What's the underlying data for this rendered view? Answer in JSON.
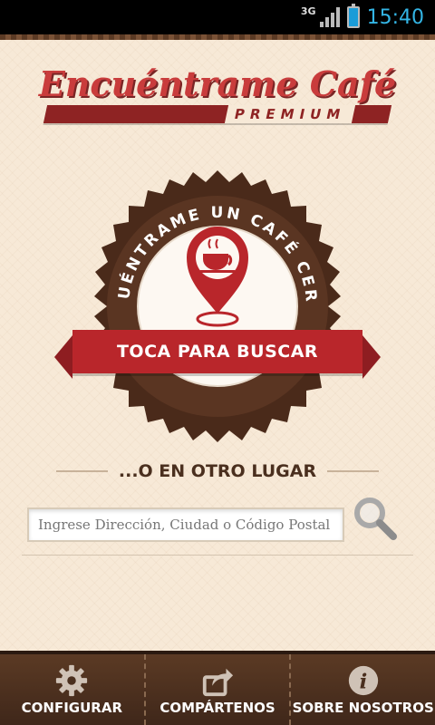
{
  "status": {
    "network": "3G",
    "time": "15:40"
  },
  "logo": {
    "title": "Encuéntrame Café",
    "subtitle": "PREMIUM"
  },
  "badge": {
    "arc_text": "ENCUÉNTRAME UN CAFÉ CERCA!",
    "cta_label": "TOCA PARA BUSCAR"
  },
  "other": {
    "heading": "...O EN OTRO LUGAR"
  },
  "search": {
    "placeholder": "Ingrese Dirección, Ciudad o Código Postal",
    "value": ""
  },
  "tabs": [
    {
      "label": "CONFIGURAR",
      "icon": "gear-icon"
    },
    {
      "label": "COMPÁRTENOS",
      "icon": "share-icon"
    },
    {
      "label": "SOBRE NOSOTROS",
      "icon": "info-icon"
    }
  ],
  "colors": {
    "brand_red": "#b9262b",
    "brown": "#4a2f1e",
    "background": "#f7e9d7",
    "clock_blue": "#33b5e5"
  }
}
